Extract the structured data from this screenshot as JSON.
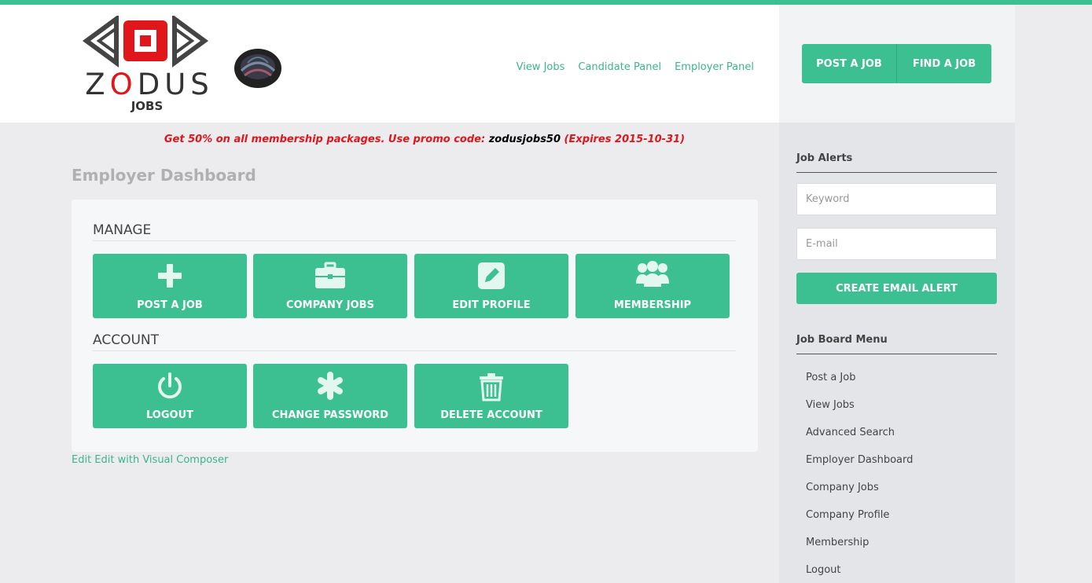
{
  "logo": {
    "text_prefix": "Z",
    "text_red": "O",
    "text_suffix": "DUS",
    "subtext": "JOBS"
  },
  "nav": {
    "items": [
      "View Jobs",
      "Candidate Panel",
      "Employer Panel"
    ]
  },
  "header_buttons": {
    "post": "POST A JOB",
    "find": "FIND A JOB"
  },
  "promo": {
    "before": "Get 50% on all membership packages. Use promo code: ",
    "code": "zodusjobs50",
    "after": " (Expires 2015-10-31)"
  },
  "page_title": "Employer Dashboard",
  "manage": {
    "title": "MANAGE",
    "tiles": [
      {
        "label": "POST A JOB",
        "icon": "plus-icon"
      },
      {
        "label": "COMPANY JOBS",
        "icon": "briefcase-icon"
      },
      {
        "label": "EDIT PROFILE",
        "icon": "edit-icon"
      },
      {
        "label": "MEMBERSHIP",
        "icon": "users-icon"
      }
    ]
  },
  "account": {
    "title": "ACCOUNT",
    "tiles": [
      {
        "label": "LOGOUT",
        "icon": "power-icon"
      },
      {
        "label": "CHANGE PASSWORD",
        "icon": "asterisk-icon"
      },
      {
        "label": "DELETE ACCOUNT",
        "icon": "trash-icon"
      }
    ]
  },
  "edit_link": "Edit Edit with Visual Composer",
  "job_alerts": {
    "title": "Job Alerts",
    "keyword_placeholder": "Keyword",
    "email_placeholder": "E-mail",
    "button": "CREATE EMAIL ALERT"
  },
  "job_board_menu": {
    "title": "Job Board Menu",
    "items": [
      "Post a Job",
      "View Jobs",
      "Advanced Search",
      "Employer Dashboard",
      "Company Jobs",
      "Company Profile",
      "Membership",
      "Logout"
    ]
  },
  "colors": {
    "accent": "#3cbf91",
    "promo_red": "#e0161b",
    "logo_red": "#e0161b"
  }
}
